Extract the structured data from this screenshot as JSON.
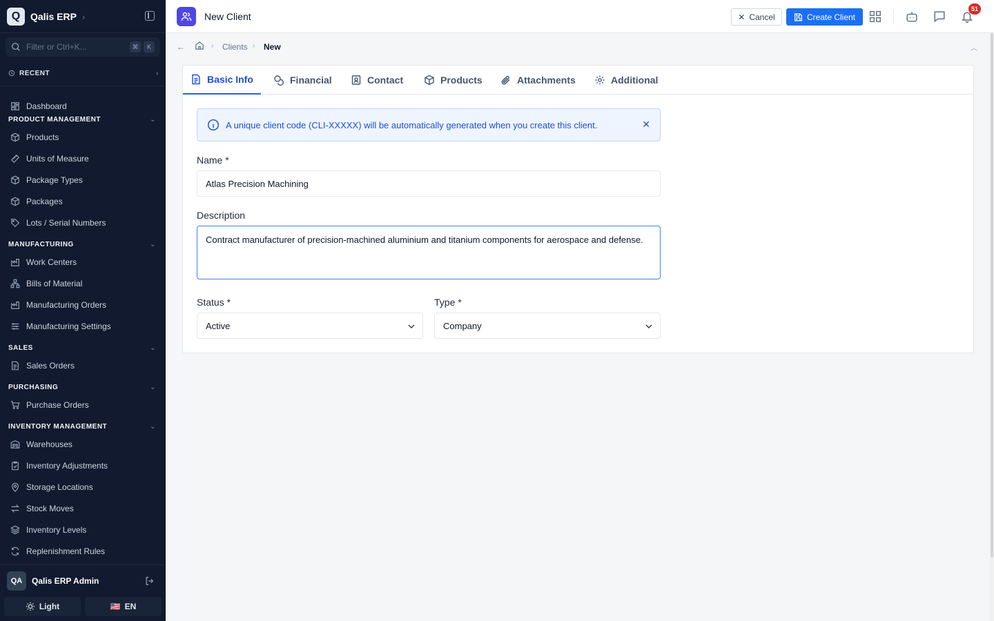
{
  "app": {
    "logo_letter": "Q",
    "name": "Qalis ERP"
  },
  "filter": {
    "placeholder": "Filter or Ctrl+K...",
    "kbd1": "⌘",
    "kbd2": "K"
  },
  "recent": {
    "label": "RECENT"
  },
  "nav": {
    "dashboard": "Dashboard",
    "product_management": {
      "title": "PRODUCT MANAGEMENT",
      "items": [
        "Products",
        "Units of Measure",
        "Package Types",
        "Packages",
        "Lots / Serial Numbers"
      ]
    },
    "manufacturing": {
      "title": "MANUFACTURING",
      "items": [
        "Work Centers",
        "Bills of Material",
        "Manufacturing Orders",
        "Manufacturing Settings"
      ]
    },
    "sales": {
      "title": "SALES",
      "items": [
        "Sales Orders"
      ]
    },
    "purchasing": {
      "title": "PURCHASING",
      "items": [
        "Purchase Orders"
      ]
    },
    "inventory": {
      "title": "INVENTORY MANAGEMENT",
      "items": [
        "Warehouses",
        "Inventory Adjustments",
        "Storage Locations",
        "Stock Moves",
        "Inventory Levels",
        "Replenishment Rules"
      ]
    }
  },
  "user": {
    "initials": "QA",
    "name": "Qalis ERP Admin"
  },
  "theme": {
    "label": "Light"
  },
  "lang": {
    "label": "EN",
    "flag": "🇺🇸"
  },
  "header": {
    "title": "New Client",
    "cancel": "Cancel",
    "create": "Create Client",
    "notifications": "51"
  },
  "breadcrumb": {
    "parent": "Clients",
    "current": "New"
  },
  "tabs": [
    "Basic Info",
    "Financial",
    "Contact",
    "Products",
    "Attachments",
    "Additional"
  ],
  "alert": {
    "text": "A unique client code (CLI-XXXXX) will be automatically generated when you create this client."
  },
  "form": {
    "name_label": "Name *",
    "name_value": "Atlas Precision Machining",
    "description_label": "Description",
    "description_value": "Contract manufacturer of precision-machined aluminium and titanium components for aerospace and defense.",
    "status_label": "Status *",
    "status_value": "Active",
    "type_label": "Type *",
    "type_value": "Company"
  },
  "colors": {
    "sidebar_bg": "#111a2e",
    "primary": "#1d6ff2",
    "accent": "#4f46e5",
    "alert_bg": "#eef5ff",
    "badge": "#dc2626"
  }
}
